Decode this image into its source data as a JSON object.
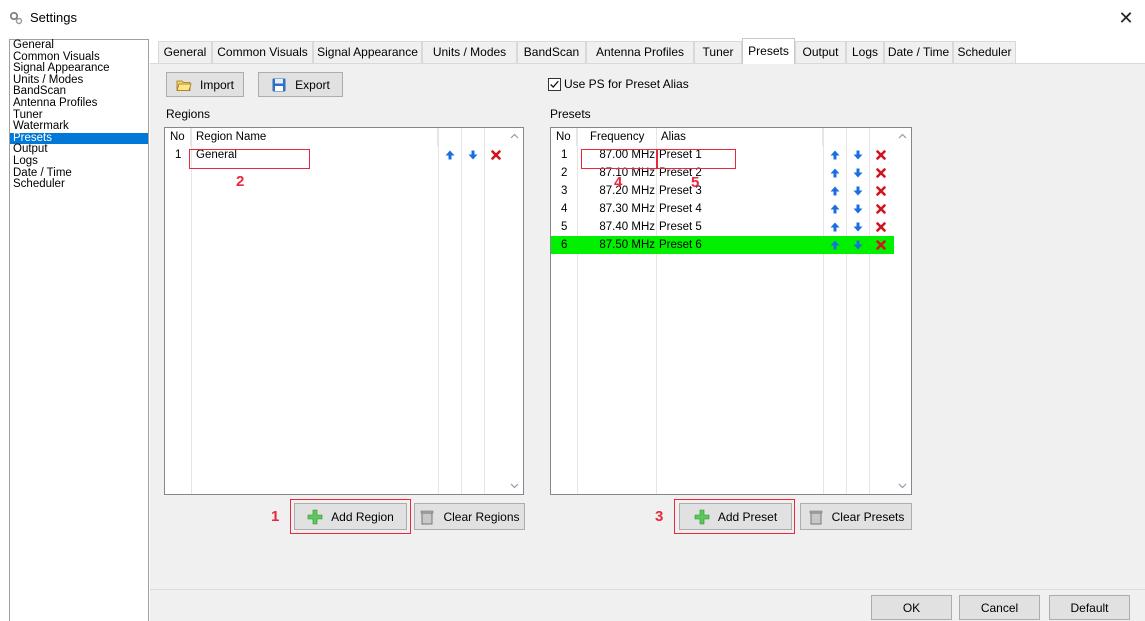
{
  "window": {
    "title": "Settings",
    "close_glyph": "✕"
  },
  "left_nav": {
    "items": [
      "General",
      "Common Visuals",
      "Signal Appearance",
      "Units / Modes",
      "BandScan",
      "Antenna Profiles",
      "Tuner",
      "Watermark",
      "Presets",
      "Output",
      "Logs",
      "Date / Time",
      "Scheduler"
    ],
    "selected_index": 8
  },
  "tabs": [
    "General",
    "Common Visuals",
    "Signal Appearance",
    "Units / Modes",
    "BandScan",
    "Antenna Profiles",
    "Tuner",
    "Presets",
    "Output",
    "Logs",
    "Date / Time",
    "Scheduler"
  ],
  "active_tab_index": 7,
  "toolbar": {
    "import_label": "Import",
    "export_label": "Export"
  },
  "use_ps": {
    "label": "Use PS for Preset Alias",
    "checked": true
  },
  "regions": {
    "label": "Regions",
    "col_no": "No",
    "col_name": "Region Name",
    "rows": [
      {
        "no": "1",
        "name": "General"
      }
    ],
    "add_label": "Add Region",
    "clear_label": "Clear Regions"
  },
  "presets": {
    "label": "Presets",
    "col_no": "No",
    "col_freq": "Frequency",
    "col_alias": "Alias",
    "rows": [
      {
        "no": "1",
        "freq": "87.00 MHz",
        "alias": "Preset 1"
      },
      {
        "no": "2",
        "freq": "87.10 MHz",
        "alias": "Preset 2"
      },
      {
        "no": "3",
        "freq": "87.20 MHz",
        "alias": "Preset 3"
      },
      {
        "no": "4",
        "freq": "87.30 MHz",
        "alias": "Preset 4"
      },
      {
        "no": "5",
        "freq": "87.40 MHz",
        "alias": "Preset 5"
      },
      {
        "no": "6",
        "freq": "87.50 MHz",
        "alias": "Preset 6"
      }
    ],
    "highlight_index": 5,
    "add_label": "Add Preset",
    "clear_label": "Clear Presets"
  },
  "annotations": [
    "1",
    "2",
    "3",
    "4",
    "5"
  ],
  "footer": {
    "ok_label": "OK",
    "cancel_label": "Cancel",
    "default_label": "Default"
  },
  "colors": {
    "selection": "#0078d7",
    "highlight_row": "#00f000",
    "annotation": "#e8293b",
    "up_arrow": "#1a6fe0",
    "delete": "#d0141e"
  }
}
